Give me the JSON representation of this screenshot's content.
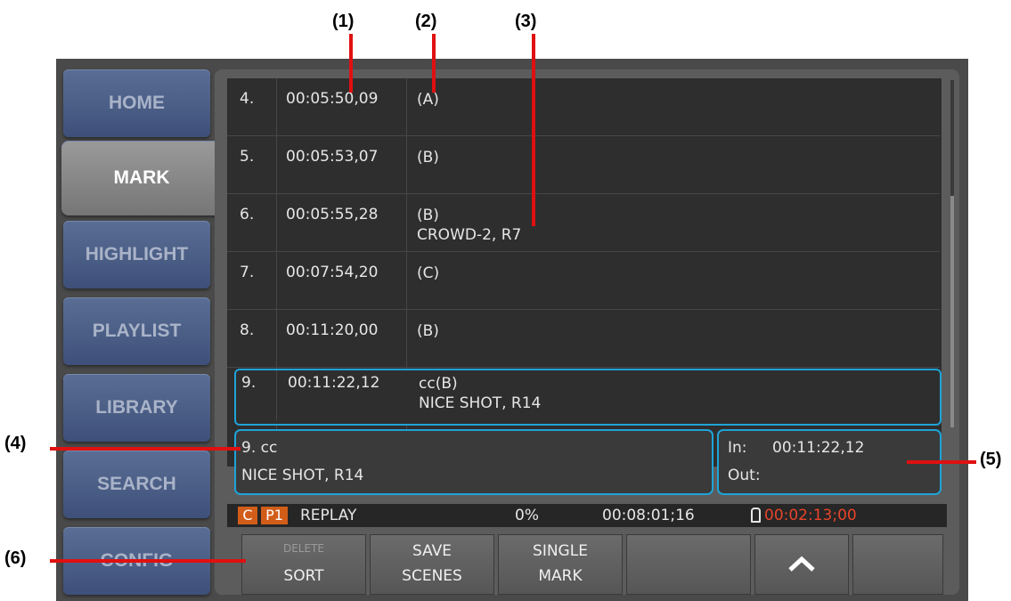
{
  "callouts": {
    "c1": "(1)",
    "c2": "(2)",
    "c3": "(3)",
    "c4": "(4)",
    "c5": "(5)",
    "c6": "(6)"
  },
  "sidebar": {
    "items": [
      {
        "label": "HOME"
      },
      {
        "label": "MARK"
      },
      {
        "label": "HIGHLIGHT"
      },
      {
        "label": "PLAYLIST"
      },
      {
        "label": "LIBRARY"
      },
      {
        "label": "SEARCH"
      },
      {
        "label": "CONFIG"
      }
    ]
  },
  "marks": [
    {
      "num": "4.",
      "tc": "00:05:50,09",
      "line1": "(A)",
      "line2": ""
    },
    {
      "num": "5.",
      "tc": "00:05:53,07",
      "line1": "(B)",
      "line2": ""
    },
    {
      "num": "6.",
      "tc": "00:05:55,28",
      "line1": "(B)",
      "line2": "CROWD-2, R7"
    },
    {
      "num": "7.",
      "tc": "00:07:54,20",
      "line1": "(C)",
      "line2": ""
    },
    {
      "num": "8.",
      "tc": "00:11:20,00",
      "line1": "(B)",
      "line2": ""
    },
    {
      "num": "9.",
      "tc": "00:11:22,12",
      "line1": "cc(B)",
      "line2": "NICE SHOT, R14"
    }
  ],
  "detail": {
    "title": "9. cc",
    "comment": "NICE SHOT, R14"
  },
  "inout": {
    "in_label": "In:",
    "in_value": "00:11:22,12",
    "out_label": "Out:",
    "out_value": ""
  },
  "status": {
    "badge_c": "C",
    "badge_p": "P1",
    "mode": "REPLAY",
    "percent": "0%",
    "timecode": "00:08:01;16",
    "remaining": "00:02:13;00",
    "remaining_color": "#e8442a"
  },
  "buttons": {
    "sort_small": "DELETE",
    "sort": "SORT",
    "save_1": "SAVE",
    "save_2": "SCENES",
    "single_1": "SINGLE",
    "single_2": "MARK",
    "up_icon": "up-chevron"
  },
  "colors": {
    "selection": "#1fa3d8",
    "callout_line": "#e01010"
  }
}
